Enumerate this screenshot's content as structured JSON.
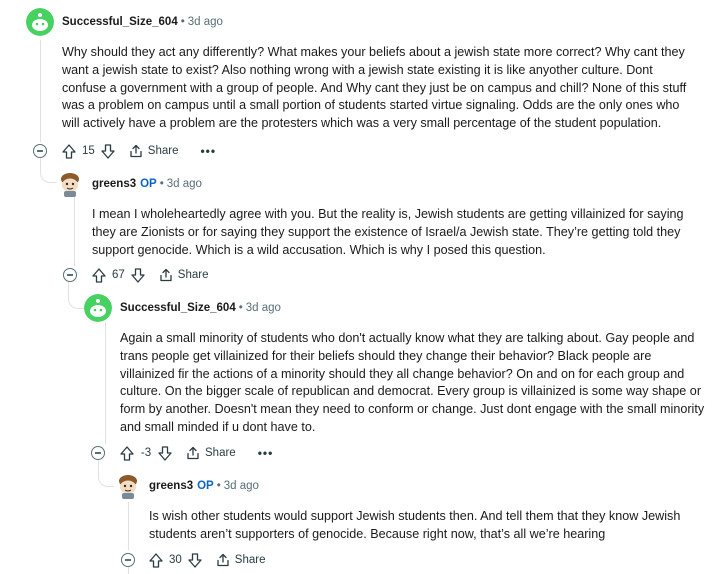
{
  "comments": [
    {
      "author": "Successful_Size_604",
      "op": "",
      "time": "3d ago",
      "body": "Why should they act any differently? What makes your beliefs about a jewish state more correct? Why cant they want a jewish state to exist? Also nothing wrong with a jewish state existing it is like anyother culture. Dont confuse a government with a group of people. And Why cant they just be on campus and chill? None of this stuff was a problem on campus until a small portion of students started virtue signaling. Odds are the only ones who will actively have a problem are the protesters which was a very small percentage of the student population.",
      "votes": "15",
      "share_label": "Share",
      "more": "•••"
    },
    {
      "author": "greens3",
      "op": "OP",
      "time": "3d ago",
      "body": "I mean I wholeheartedly agree with you. But the reality is, Jewish students are getting villainized for saying they are Zionists or for saying they support the existence of Israel/a Jewish state. They’re getting told they support genocide. Which is a wild accusation. Which is why I posed this question.",
      "votes": "67",
      "share_label": "Share",
      "more": ""
    },
    {
      "author": "Successful_Size_604",
      "op": "",
      "time": "3d ago",
      "body": "Again a small minority of students who don't actually know what they are talking about. Gay people and trans people get villainized for their beliefs should they change their behavior? Black people are villainized fir the actions of a minority should they all change behavior? On and on for each group and culture. On the bigger scale of republican and democrat. Every group is villainized is some way shape or form by another. Doesn't mean they need to conform or change. Just dont engage with the small minority and small minded if u dont have to.",
      "votes": "-3",
      "share_label": "Share",
      "more": "•••"
    },
    {
      "author": "greens3",
      "op": "OP",
      "time": "3d ago",
      "body": "Is wish other students would support Jewish students then. And tell them that they know Jewish students aren’t supporters of genocide. Because right now, that’s all we’re hearing",
      "votes": "30",
      "share_label": "Share",
      "more": ""
    }
  ],
  "icons": {
    "collapse": "collapse-minus-icon",
    "upvote": "upvote-arrow-icon",
    "downvote": "downvote-arrow-icon",
    "share": "share-icon",
    "more": "more-options-icon"
  },
  "colors": {
    "green_avatar": "#46d160",
    "op_blue": "#0a66c2",
    "meta_gray": "#576f76",
    "thread_line": "#dfe1e3"
  }
}
